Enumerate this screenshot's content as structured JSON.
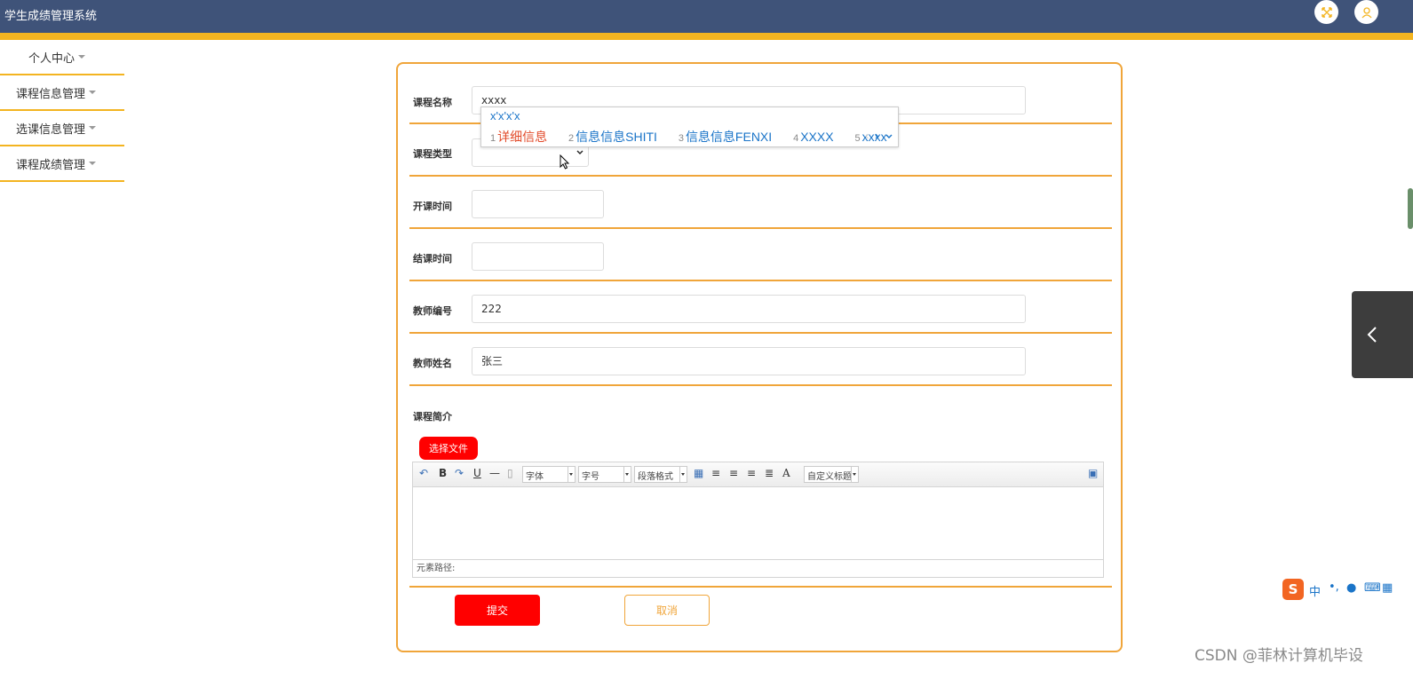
{
  "app": {
    "title": "学生成绩管理系统"
  },
  "header": {
    "icons": [
      "fullscreen-icon",
      "user-icon"
    ]
  },
  "sidebar": {
    "items": [
      {
        "label": "个人中心"
      },
      {
        "label": "课程信息管理"
      },
      {
        "label": "选课信息管理"
      },
      {
        "label": "课程成绩管理"
      }
    ]
  },
  "form": {
    "course_name": {
      "label": "课程名称",
      "value": "xxxx"
    },
    "course_type": {
      "label": "课程类型",
      "value": ""
    },
    "start_time": {
      "label": "开课时间",
      "value": ""
    },
    "end_time": {
      "label": "结课时间",
      "value": ""
    },
    "teacher_id": {
      "label": "教师编号",
      "value": "222"
    },
    "teacher_name": {
      "label": "教师姓名",
      "value": "张三"
    },
    "course_intro": {
      "label": "课程简介"
    },
    "file_button": "选择文件",
    "editor": {
      "font_family": "字体",
      "font_size": "字号",
      "paragraph": "段落格式",
      "custom_title": "自定义标题",
      "path_label": "元素路径:"
    },
    "submit_label": "提交",
    "cancel_label": "取消"
  },
  "ime": {
    "pinyin": "x'x'x'x",
    "candidates": [
      {
        "num": "1",
        "text": "详细信息"
      },
      {
        "num": "2",
        "text": "信息信息SHITI"
      },
      {
        "num": "3",
        "text": "信息信息FENXI"
      },
      {
        "num": "4",
        "text": "XXXX"
      },
      {
        "num": "5",
        "text": "xxxx"
      }
    ],
    "bar_text": "中"
  },
  "watermark": "CSDN @菲林计算机毕设",
  "colors": {
    "header": "#3f5379",
    "accent": "#f3b420",
    "border": "#f0a53a",
    "primary_button": "#ff0000"
  }
}
